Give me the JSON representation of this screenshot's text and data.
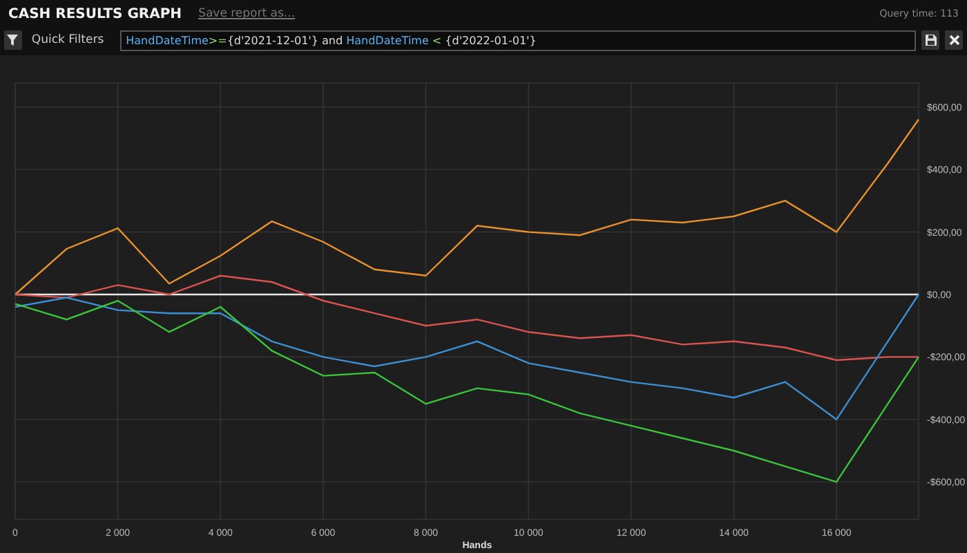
{
  "header": {
    "title": "CASH RESULTS GRAPH",
    "save_link": "Save report as...",
    "query_time": "Query time: 113"
  },
  "filter_bar": {
    "label": "Quick Filters",
    "tokens": [
      {
        "kind": "field",
        "text": "HandDateTime"
      },
      {
        "kind": "operator",
        "text": ">="
      },
      {
        "kind": "text",
        "text": "{d'2021-12-01'} and "
      },
      {
        "kind": "field",
        "text": "HandDateTime"
      },
      {
        "kind": "operator",
        "text": " < "
      },
      {
        "kind": "text",
        "text": "{d'2022-01-01'}"
      }
    ]
  },
  "chart_data": {
    "type": "line",
    "xlabel": "Hands",
    "x": [
      0,
      1000,
      2000,
      3000,
      4000,
      5000,
      6000,
      7000,
      8000,
      9000,
      10000,
      11000,
      12000,
      13000,
      14000,
      15000,
      16000,
      17000,
      17600
    ],
    "series": [
      {
        "color": "#e8912e",
        "values": [
          0,
          146,
          212,
          35,
          124,
          234,
          168,
          80,
          60,
          220,
          200,
          190,
          240,
          230,
          250,
          300,
          200,
          420,
          560
        ]
      },
      {
        "color": "#d9534f",
        "values": [
          0,
          -10,
          30,
          0,
          60,
          40,
          -20,
          -60,
          -100,
          -80,
          -120,
          -140,
          -130,
          -160,
          -150,
          -170,
          -210,
          -200,
          -200
        ]
      },
      {
        "color": "#3d8fd1",
        "values": [
          -40,
          -10,
          -50,
          -60,
          -60,
          -150,
          -200,
          -230,
          -200,
          -150,
          -220,
          -250,
          -280,
          -300,
          -330,
          -280,
          -400,
          -150,
          0
        ]
      },
      {
        "color": "#3cc33c",
        "values": [
          -30,
          -80,
          -20,
          -120,
          -40,
          -180,
          -260,
          -250,
          -350,
          -300,
          -320,
          -380,
          -420,
          -460,
          -500,
          -550,
          -600,
          -350,
          -200
        ]
      }
    ],
    "xlim": [
      0,
      17600
    ],
    "ylim": [
      -720,
      677
    ],
    "grid": true,
    "xticks": [
      {
        "value": 0,
        "label": "0"
      },
      {
        "value": 2000,
        "label": "2 000"
      },
      {
        "value": 4000,
        "label": "4 000"
      },
      {
        "value": 6000,
        "label": "6 000"
      },
      {
        "value": 8000,
        "label": "8 000"
      },
      {
        "value": 10000,
        "label": "10 000"
      },
      {
        "value": 12000,
        "label": "12 000"
      },
      {
        "value": 14000,
        "label": "14 000"
      },
      {
        "value": 16000,
        "label": "16 000"
      }
    ],
    "yticks": [
      {
        "value": 600,
        "label": "$600,00"
      },
      {
        "value": 400,
        "label": "$400,00"
      },
      {
        "value": 200,
        "label": "$200,00"
      },
      {
        "value": 0,
        "label": "$0,00"
      },
      {
        "value": -200,
        "label": "-$200,00"
      },
      {
        "value": -400,
        "label": "-$400,00"
      },
      {
        "value": -600,
        "label": "-$600,00"
      }
    ]
  }
}
